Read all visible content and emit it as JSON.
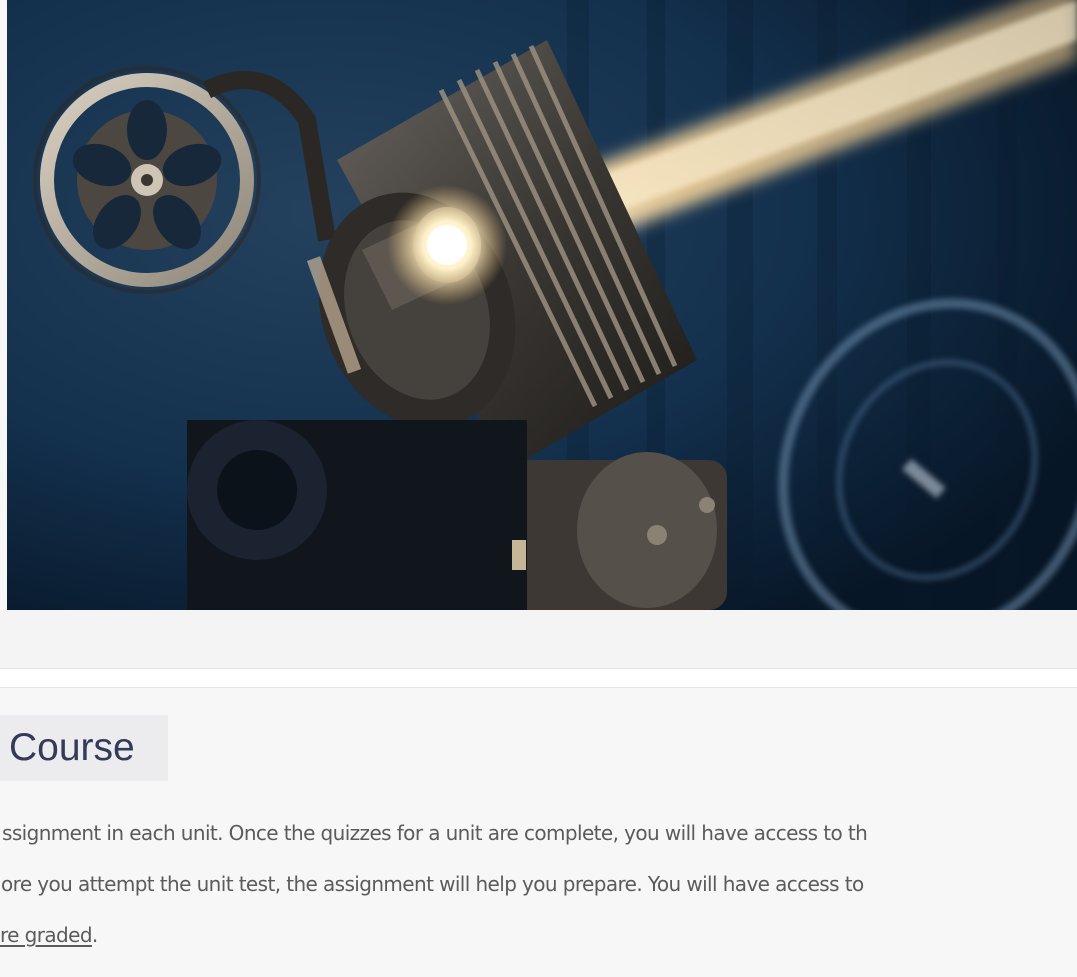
{
  "hero": {
    "image": "film-projector-photo",
    "colors": {
      "background": "#0c1f33",
      "beam": "#f6d7a3",
      "metal": "#c9b9a1"
    }
  },
  "course": {
    "title": "Course",
    "description": {
      "line1": "ssignment in each unit. Once the quizzes for a unit are complete, you will have access to th",
      "line2": "ore you attempt the unit test, the assignment will help you prepare. You will have access to",
      "line3_link": "re graded",
      "line3_after": "."
    }
  },
  "colors": {
    "title": "#343a58",
    "text": "#5b5b5b",
    "page_bg": "#f7f7f8"
  }
}
